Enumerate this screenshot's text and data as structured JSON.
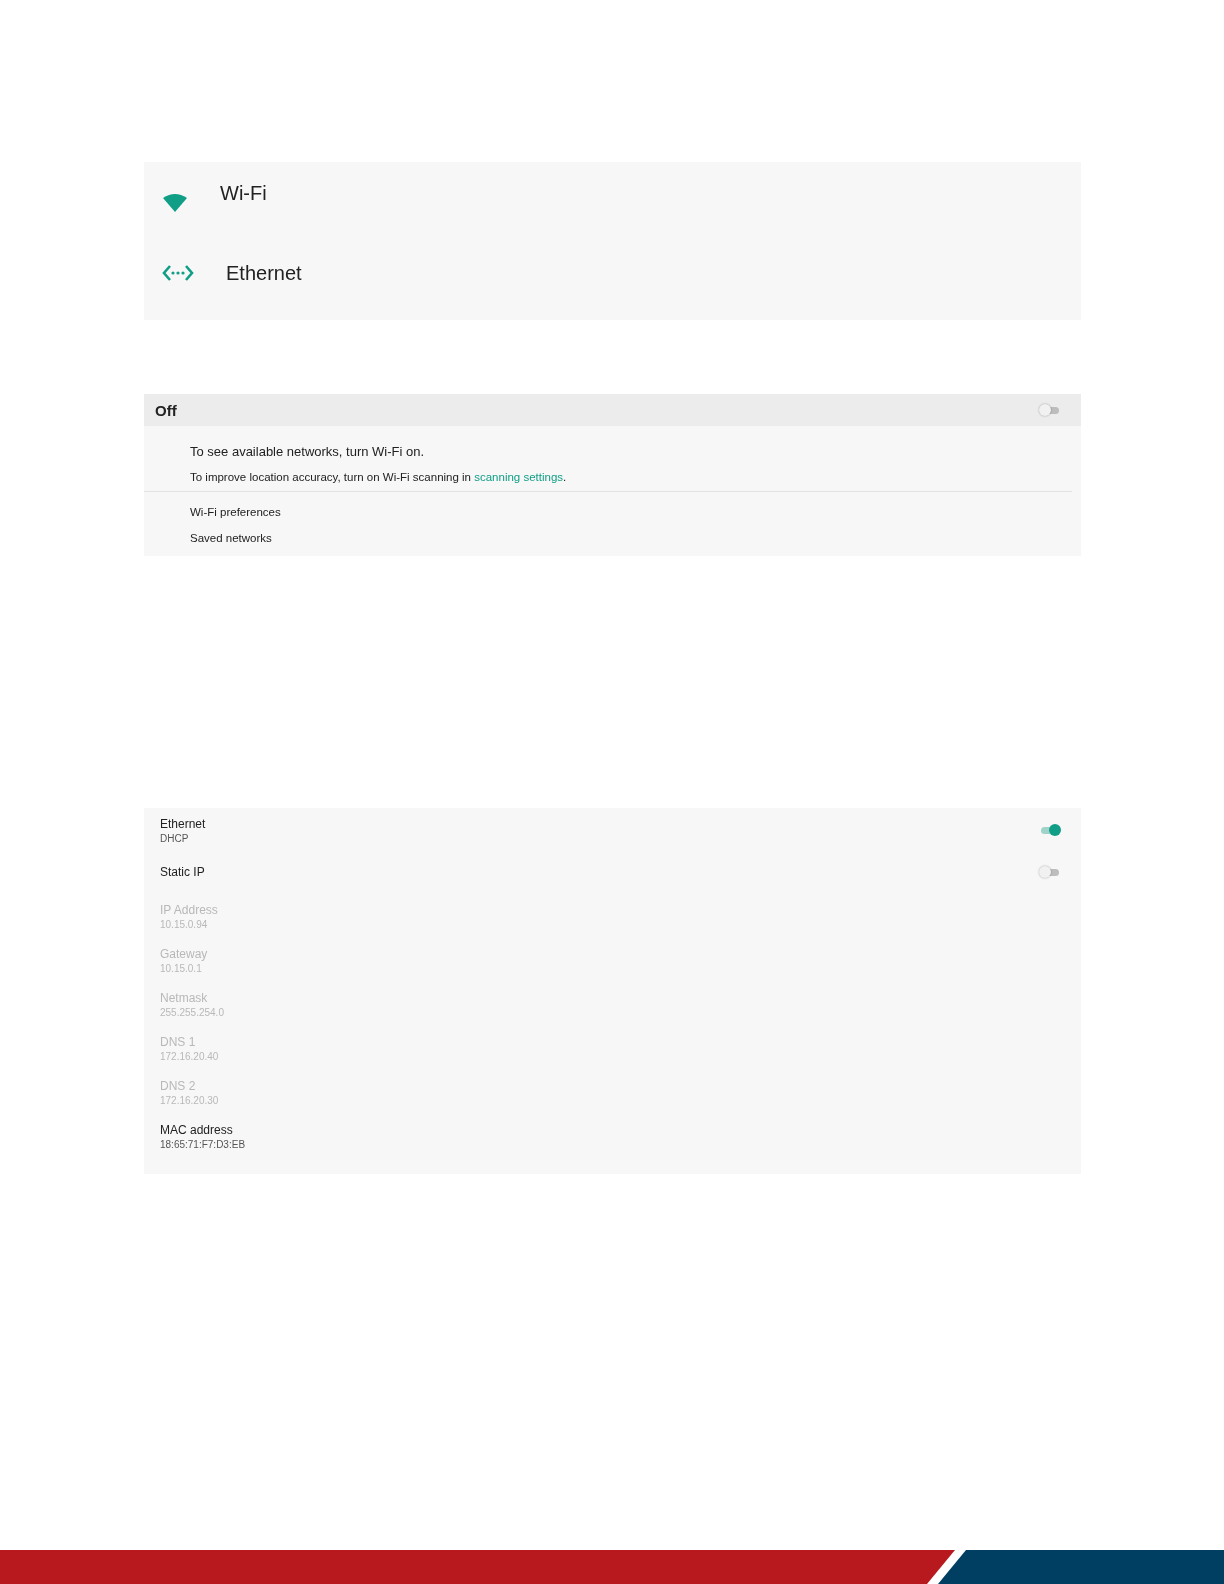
{
  "menu": {
    "items": [
      {
        "label": "Wi-Fi",
        "kind": "wifi"
      },
      {
        "label": "Ethernet",
        "kind": "ethernet"
      }
    ]
  },
  "wifi": {
    "switch_label": "Off",
    "on": false,
    "message": "To see available networks, turn Wi-Fi on.",
    "hint": "To improve location accuracy, turn on Wi-Fi scanning in ",
    "hint_link": "scanning settings",
    "hint_end": ".",
    "items": [
      "Wi-Fi preferences",
      "Saved networks"
    ]
  },
  "ethernet": {
    "rows": [
      {
        "kind": "switch",
        "title": "Ethernet",
        "summary": "DHCP",
        "disabled": false,
        "on": true
      },
      {
        "kind": "switch",
        "title": "Static IP",
        "disabled": false,
        "on": false
      },
      {
        "kind": "info",
        "title": "IP Address",
        "summary": "10.15.0.94",
        "disabled": true
      },
      {
        "kind": "info",
        "title": "Gateway",
        "summary": "10.15.0.1",
        "disabled": true
      },
      {
        "kind": "info",
        "title": "Netmask",
        "summary": "255.255.254.0",
        "disabled": true
      },
      {
        "kind": "info",
        "title": "DNS 1",
        "summary": "172.16.20.40",
        "disabled": true
      },
      {
        "kind": "info",
        "title": "DNS 2",
        "summary": "172.16.20.30",
        "disabled": true
      },
      {
        "kind": "info",
        "title": "MAC address",
        "summary": "18:65:71:F7:D3:EB",
        "disabled": false
      }
    ]
  }
}
